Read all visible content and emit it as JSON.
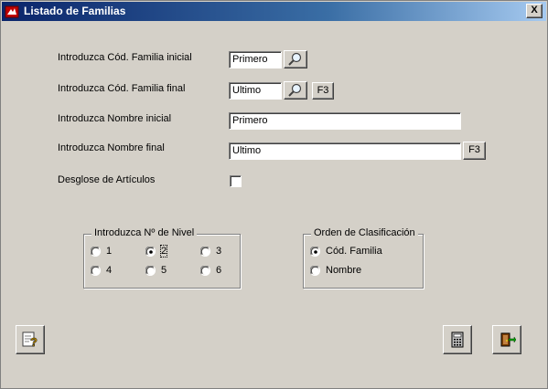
{
  "window": {
    "title": "Listado de Familias",
    "close_label": "X"
  },
  "form": {
    "cod_familia_inicial": {
      "label": "Introduzca Cód. Familia inicial",
      "value": "Primero"
    },
    "cod_familia_final": {
      "label": "Introduzca Cód. Familia final",
      "value": "Ultimo",
      "f3_label": "F3"
    },
    "nombre_inicial": {
      "label": "Introduzca Nombre inicial",
      "value": "Primero"
    },
    "nombre_final": {
      "label": "Introduzca Nombre final",
      "value": "Ultimo",
      "f3_label": "F3"
    },
    "desglose": {
      "label": "Desglose de Artículos",
      "checked": false
    }
  },
  "nivel_group": {
    "title": "Introduzca Nº de Nivel",
    "options": [
      "1",
      "2",
      "3",
      "4",
      "5",
      "6"
    ],
    "selected": "2"
  },
  "orden_group": {
    "title": "Orden de Clasificación",
    "options": [
      "Cód. Familia",
      "Nombre"
    ],
    "selected": "Cód. Familia"
  },
  "toolbar": {
    "help_icon": "help-icon",
    "calculator_icon": "calculator-icon",
    "exit_icon": "exit-door-icon"
  }
}
